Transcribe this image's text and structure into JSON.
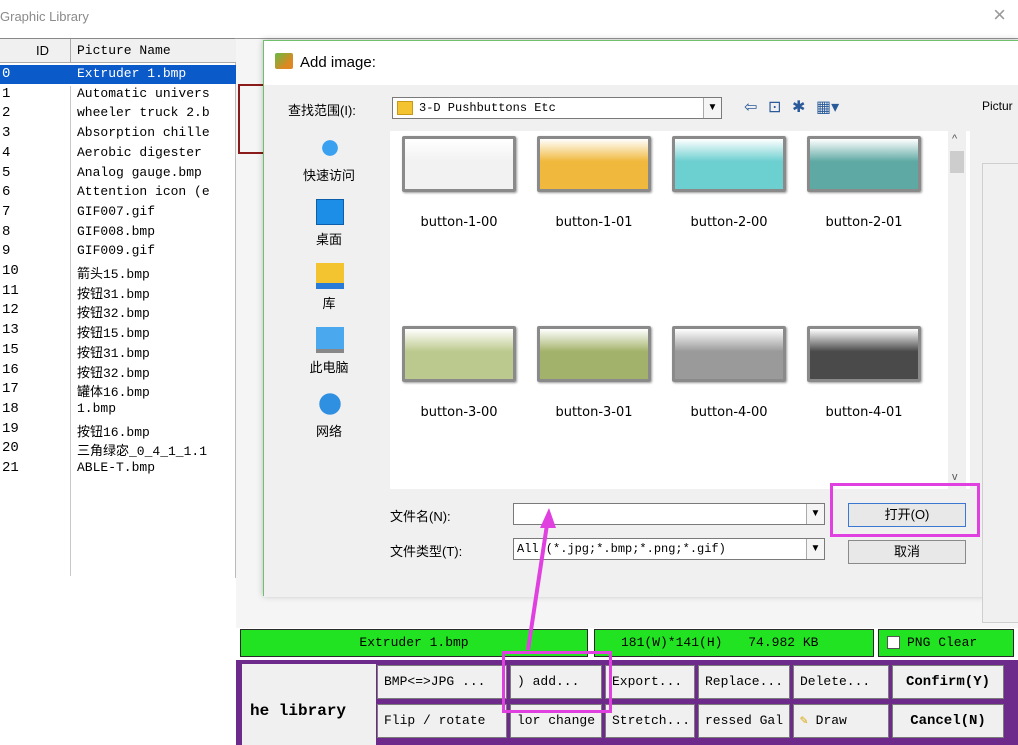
{
  "window": {
    "title": "Graphic Library",
    "close_glyph": "×"
  },
  "list": {
    "col_id": "ID",
    "col_name": "Picture Name",
    "rows": [
      {
        "id": "0",
        "name": "Extruder 1.bmp"
      },
      {
        "id": "1",
        "name": "Automatic univers"
      },
      {
        "id": "2",
        "name": "wheeler truck 2.b"
      },
      {
        "id": "3",
        "name": "Absorption chille"
      },
      {
        "id": "4",
        "name": "Aerobic digester"
      },
      {
        "id": "5",
        "name": "Analog gauge.bmp"
      },
      {
        "id": "6",
        "name": "Attention icon (e"
      },
      {
        "id": "7",
        "name": "GIF007.gif"
      },
      {
        "id": "8",
        "name": "GIF008.bmp"
      },
      {
        "id": "9",
        "name": "GIF009.gif"
      },
      {
        "id": "10",
        "name": "箭头15.bmp"
      },
      {
        "id": "11",
        "name": "按钮31.bmp"
      },
      {
        "id": "12",
        "name": "按钮32.bmp"
      },
      {
        "id": "13",
        "name": "按钮15.bmp"
      },
      {
        "id": "15",
        "name": "按钮31.bmp"
      },
      {
        "id": "16",
        "name": "按钮32.bmp"
      },
      {
        "id": "17",
        "name": "罐体16.bmp"
      },
      {
        "id": "18",
        "name": "1.bmp"
      },
      {
        "id": "19",
        "name": "按钮16.bmp"
      },
      {
        "id": "20",
        "name": "三角绿宓_0_4_1_1.1"
      },
      {
        "id": "21",
        "name": "ABLE-T.bmp"
      }
    ]
  },
  "dialog": {
    "title": "Add image:",
    "look_in_label": "查找范围(I):",
    "look_in_value": "3-D Pushbuttons Etc",
    "picture_label": "Pictur",
    "places": [
      {
        "label": "快速访问",
        "icon": "quick-access-icon"
      },
      {
        "label": "桌面",
        "icon": "desktop-icon"
      },
      {
        "label": "库",
        "icon": "library-icon"
      },
      {
        "label": "此电脑",
        "icon": "this-pc-icon"
      },
      {
        "label": "网络",
        "icon": "network-icon"
      }
    ],
    "files": [
      {
        "label": "button-1-00",
        "color": "#f2f2f2"
      },
      {
        "label": "button-1-01",
        "color": "#f0b83c"
      },
      {
        "label": "button-2-00",
        "color": "#6ccfd0"
      },
      {
        "label": "button-2-01",
        "color": "#5fa9a4"
      },
      {
        "label": "button-3-00",
        "color": "#bcc98e"
      },
      {
        "label": "button-3-01",
        "color": "#a3b26a"
      },
      {
        "label": "button-4-00",
        "color": "#9a9a9a"
      },
      {
        "label": "button-4-01",
        "color": "#4a4a4a"
      }
    ],
    "filename_label": "文件名(N):",
    "filename_value": "",
    "filetype_label": "文件类型(T):",
    "filetype_value": "All (*.jpg;*.bmp;*.png;*.gif)",
    "open_label": "打开(O)",
    "cancel_label": "取消"
  },
  "status": {
    "filename": "Extruder 1.bmp",
    "dims": "181(W)*141(H)",
    "size": "74.982 KB",
    "png_clear": "PNG Clear"
  },
  "toolbar": {
    "library_label": "he library",
    "bmp_jpg": "BMP<=>JPG ...",
    "add": ") add...",
    "export": "Export...",
    "replace": "Replace...",
    "delete": "Delete...",
    "confirm": "Confirm(Y)",
    "flip": "Flip / rotate",
    "color_change": "lor change",
    "stretch": "Stretch...",
    "compressed": "ressed Gal",
    "draw": "Draw",
    "cancel": "Cancel(N)"
  },
  "colors": {
    "highlight": "#e040e0",
    "status_green": "#22e322",
    "selection": "#0a5ac9",
    "panel_purple": "#6e2a8a"
  }
}
